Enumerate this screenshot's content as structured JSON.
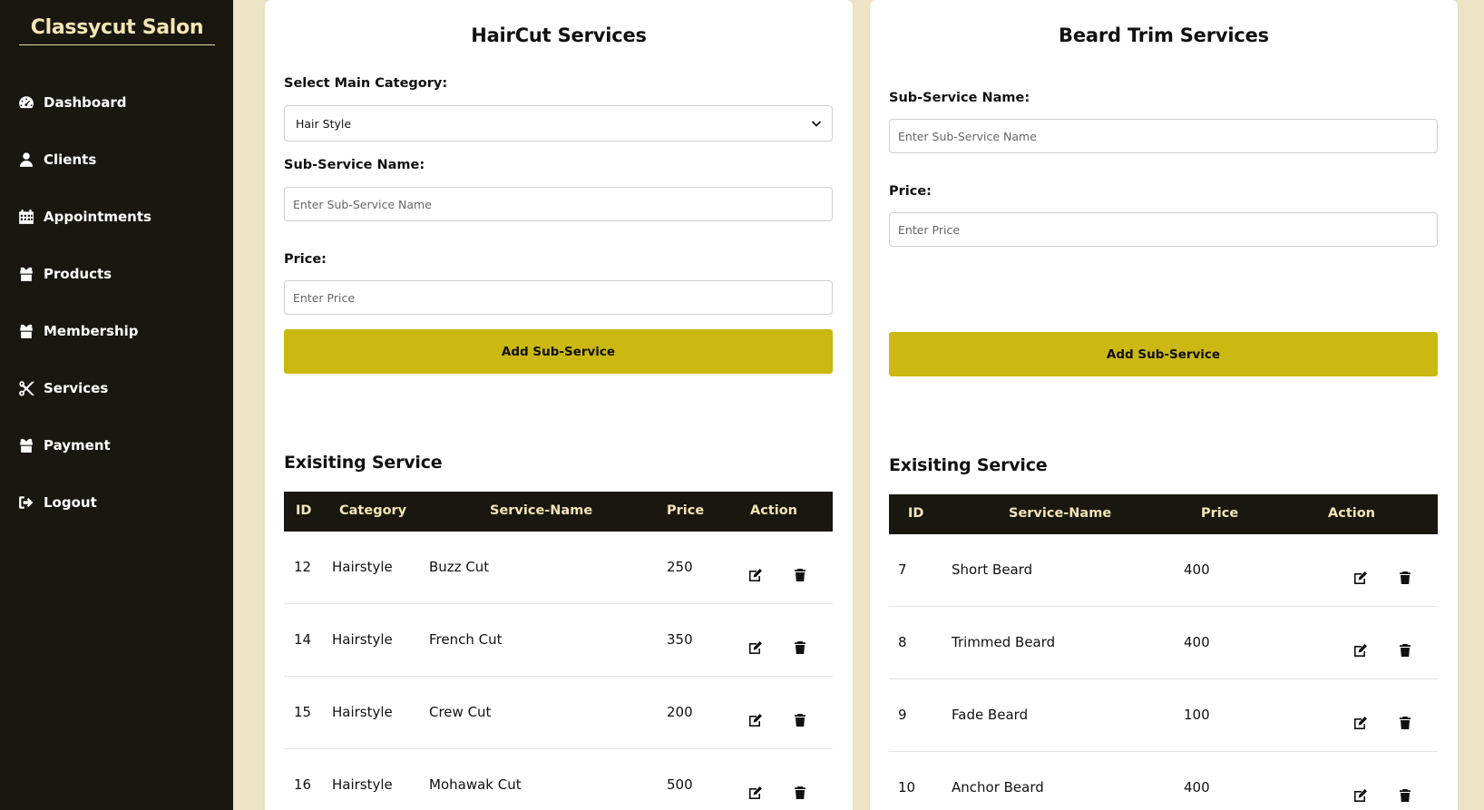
{
  "sidebar": {
    "brand": "Classycut Salon",
    "items": [
      {
        "label": "Dashboard",
        "icon": "gauge-icon"
      },
      {
        "label": "Clients",
        "icon": "user-icon"
      },
      {
        "label": "Appointments",
        "icon": "calendar-icon"
      },
      {
        "label": "Products",
        "icon": "gift-icon"
      },
      {
        "label": "Membership",
        "icon": "gift-icon"
      },
      {
        "label": "Services",
        "icon": "scissors-icon"
      },
      {
        "label": "Payment",
        "icon": "gift-icon"
      },
      {
        "label": "Logout",
        "icon": "sign-out-icon"
      }
    ]
  },
  "haircut": {
    "title": "HairCut Services",
    "category_label": "Select Main Category:",
    "category_value": "Hair Style",
    "subservice_label": "Sub-Service Name:",
    "subservice_placeholder": "Enter Sub-Service Name",
    "price_label": "Price:",
    "price_placeholder": "Enter Price",
    "add_button": "Add Sub-Service",
    "existing_title": "Exisiting Service",
    "columns": [
      "ID",
      "Category",
      "Service-Name",
      "Price",
      "Action"
    ],
    "rows": [
      {
        "id": "12",
        "category": "Hairstyle",
        "name": "Buzz Cut",
        "price": "250"
      },
      {
        "id": "14",
        "category": "Hairstyle",
        "name": "French Cut",
        "price": "350"
      },
      {
        "id": "15",
        "category": "Hairstyle",
        "name": "Crew Cut",
        "price": "200"
      },
      {
        "id": "16",
        "category": "Hairstyle",
        "name": "Mohawak Cut",
        "price": "500"
      }
    ]
  },
  "beard": {
    "title": "Beard Trim Services",
    "subservice_label": "Sub-Service Name:",
    "subservice_placeholder": "Enter Sub-Service Name",
    "price_label": "Price:",
    "price_placeholder": "Enter Price",
    "add_button": "Add Sub-Service",
    "existing_title": "Exisiting Service",
    "columns": [
      "ID",
      "Service-Name",
      "Price",
      "Action"
    ],
    "rows": [
      {
        "id": "7",
        "name": "Short Beard",
        "price": "400"
      },
      {
        "id": "8",
        "name": "Trimmed Beard",
        "price": "400"
      },
      {
        "id": "9",
        "name": "Fade Beard",
        "price": "100"
      },
      {
        "id": "10",
        "name": "Anchor Beard",
        "price": "400"
      }
    ]
  },
  "colors": {
    "sidebar_bg": "#1a1710",
    "page_bg": "#ece4c4",
    "accent": "#cbb811",
    "brand_text": "#f3e6b5"
  }
}
